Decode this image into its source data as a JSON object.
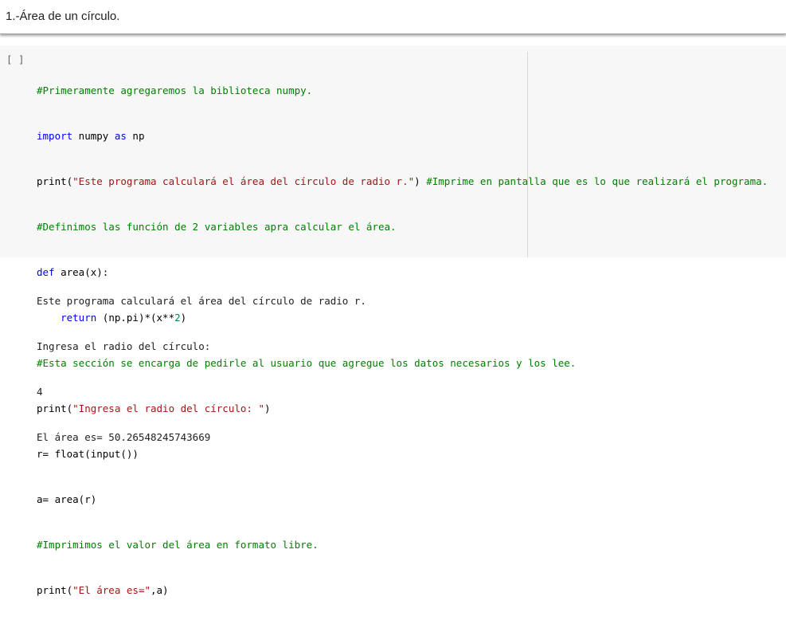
{
  "text_cell": {
    "heading": "1.-Área de un círculo."
  },
  "code_cell": {
    "run_button": "[ ]",
    "lines": [
      {
        "segments": [
          {
            "t": "#Primeramente agregaremos la biblioteca numpy."
          }
        ]
      },
      {
        "segments": [
          {
            "t": "import"
          },
          {
            "t": " numpy "
          },
          {
            "t": "as"
          },
          {
            "t": " np"
          }
        ]
      },
      {
        "segments": [
          {
            "t": "print("
          },
          {
            "t": "\"Este programa calculará el área del círculo de radio r.\""
          },
          {
            "t": ") "
          },
          {
            "t": "#Imprime en pantalla que es lo que realizará el programa."
          }
        ]
      },
      {
        "segments": [
          {
            "t": "#Definimos las función de 2 variables apra calcular el área."
          }
        ]
      },
      {
        "segments": [
          {
            "t": "def"
          },
          {
            "t": " area(x):"
          }
        ]
      },
      {
        "segments": [
          {
            "t": "    "
          },
          {
            "t": "return"
          },
          {
            "t": " (np.pi)*(x**"
          },
          {
            "t": "2"
          },
          {
            "t": ")"
          }
        ]
      },
      {
        "segments": [
          {
            "t": "#Esta sección se encarga de pedirle al usuario que agregue los datos necesarios y los lee."
          }
        ]
      },
      {
        "segments": [
          {
            "t": "print("
          },
          {
            "t": "\"Ingresa el radio del círculo: \""
          },
          {
            "t": ")"
          }
        ]
      },
      {
        "segments": [
          {
            "t": "r= float(input())"
          }
        ]
      },
      {
        "segments": [
          {
            "t": "a= area(r)"
          }
        ]
      },
      {
        "segments": [
          {
            "t": "#Imprimimos el valor del área en formato libre."
          }
        ]
      },
      {
        "segments": [
          {
            "t": "print("
          },
          {
            "t": "\"El área es=\""
          },
          {
            "t": ",a)"
          }
        ]
      }
    ]
  },
  "output": {
    "lines": [
      "Este programa calculará el área del círculo de radio r.",
      "Ingresa el radio del círculo:",
      "4",
      "El área es= 50.26548245743669"
    ]
  }
}
